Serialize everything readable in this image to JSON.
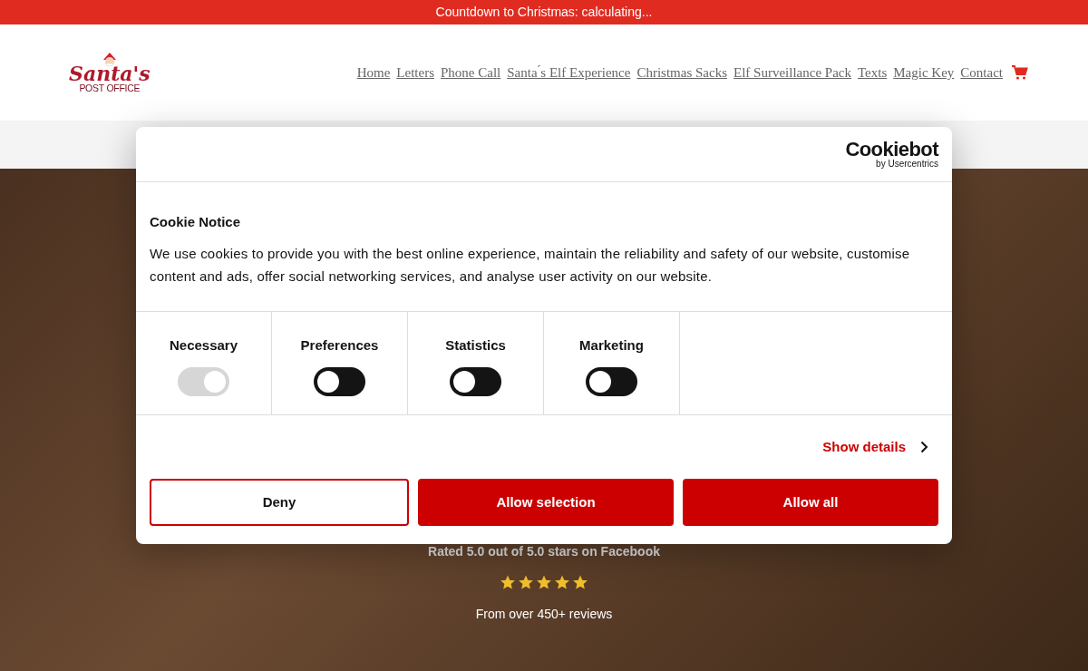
{
  "announcement": "Countdown to Christmas: calculating...",
  "logo": {
    "line_1": "Santa's",
    "line_2": "POST OFFICE"
  },
  "nav": [
    "Home",
    "Letters",
    "Phone Call",
    "Santa ́s Elf Experience",
    "Christmas Sacks",
    "Elf Surveillance Pack",
    "Texts",
    "Magic Key",
    "Contact"
  ],
  "hero": {
    "rating": "Rated 5.0 out of 5.0 stars on Facebook",
    "stars": 5,
    "reviews": "From over 450+ reviews"
  },
  "cookie_dialog": {
    "brand": "Cookiebot",
    "brand_sub": "by Usercentrics",
    "title": "Cookie Notice",
    "body": "We use cookies to provide you with the best online experience, maintain the reliability and safety of our website, customise content and ads, offer social networking services, and analyse user activity on our website.",
    "categories": [
      {
        "label": "Necessary",
        "checked": true,
        "disabled": true
      },
      {
        "label": "Preferences",
        "checked": false,
        "disabled": false
      },
      {
        "label": "Statistics",
        "checked": false,
        "disabled": false
      },
      {
        "label": "Marketing",
        "checked": false,
        "disabled": false
      }
    ],
    "details_link": "Show details",
    "buttons": [
      {
        "label": "Deny",
        "kind": "outline"
      },
      {
        "label": "Allow selection",
        "kind": "filled"
      },
      {
        "label": "Allow all",
        "kind": "filled"
      }
    ]
  }
}
